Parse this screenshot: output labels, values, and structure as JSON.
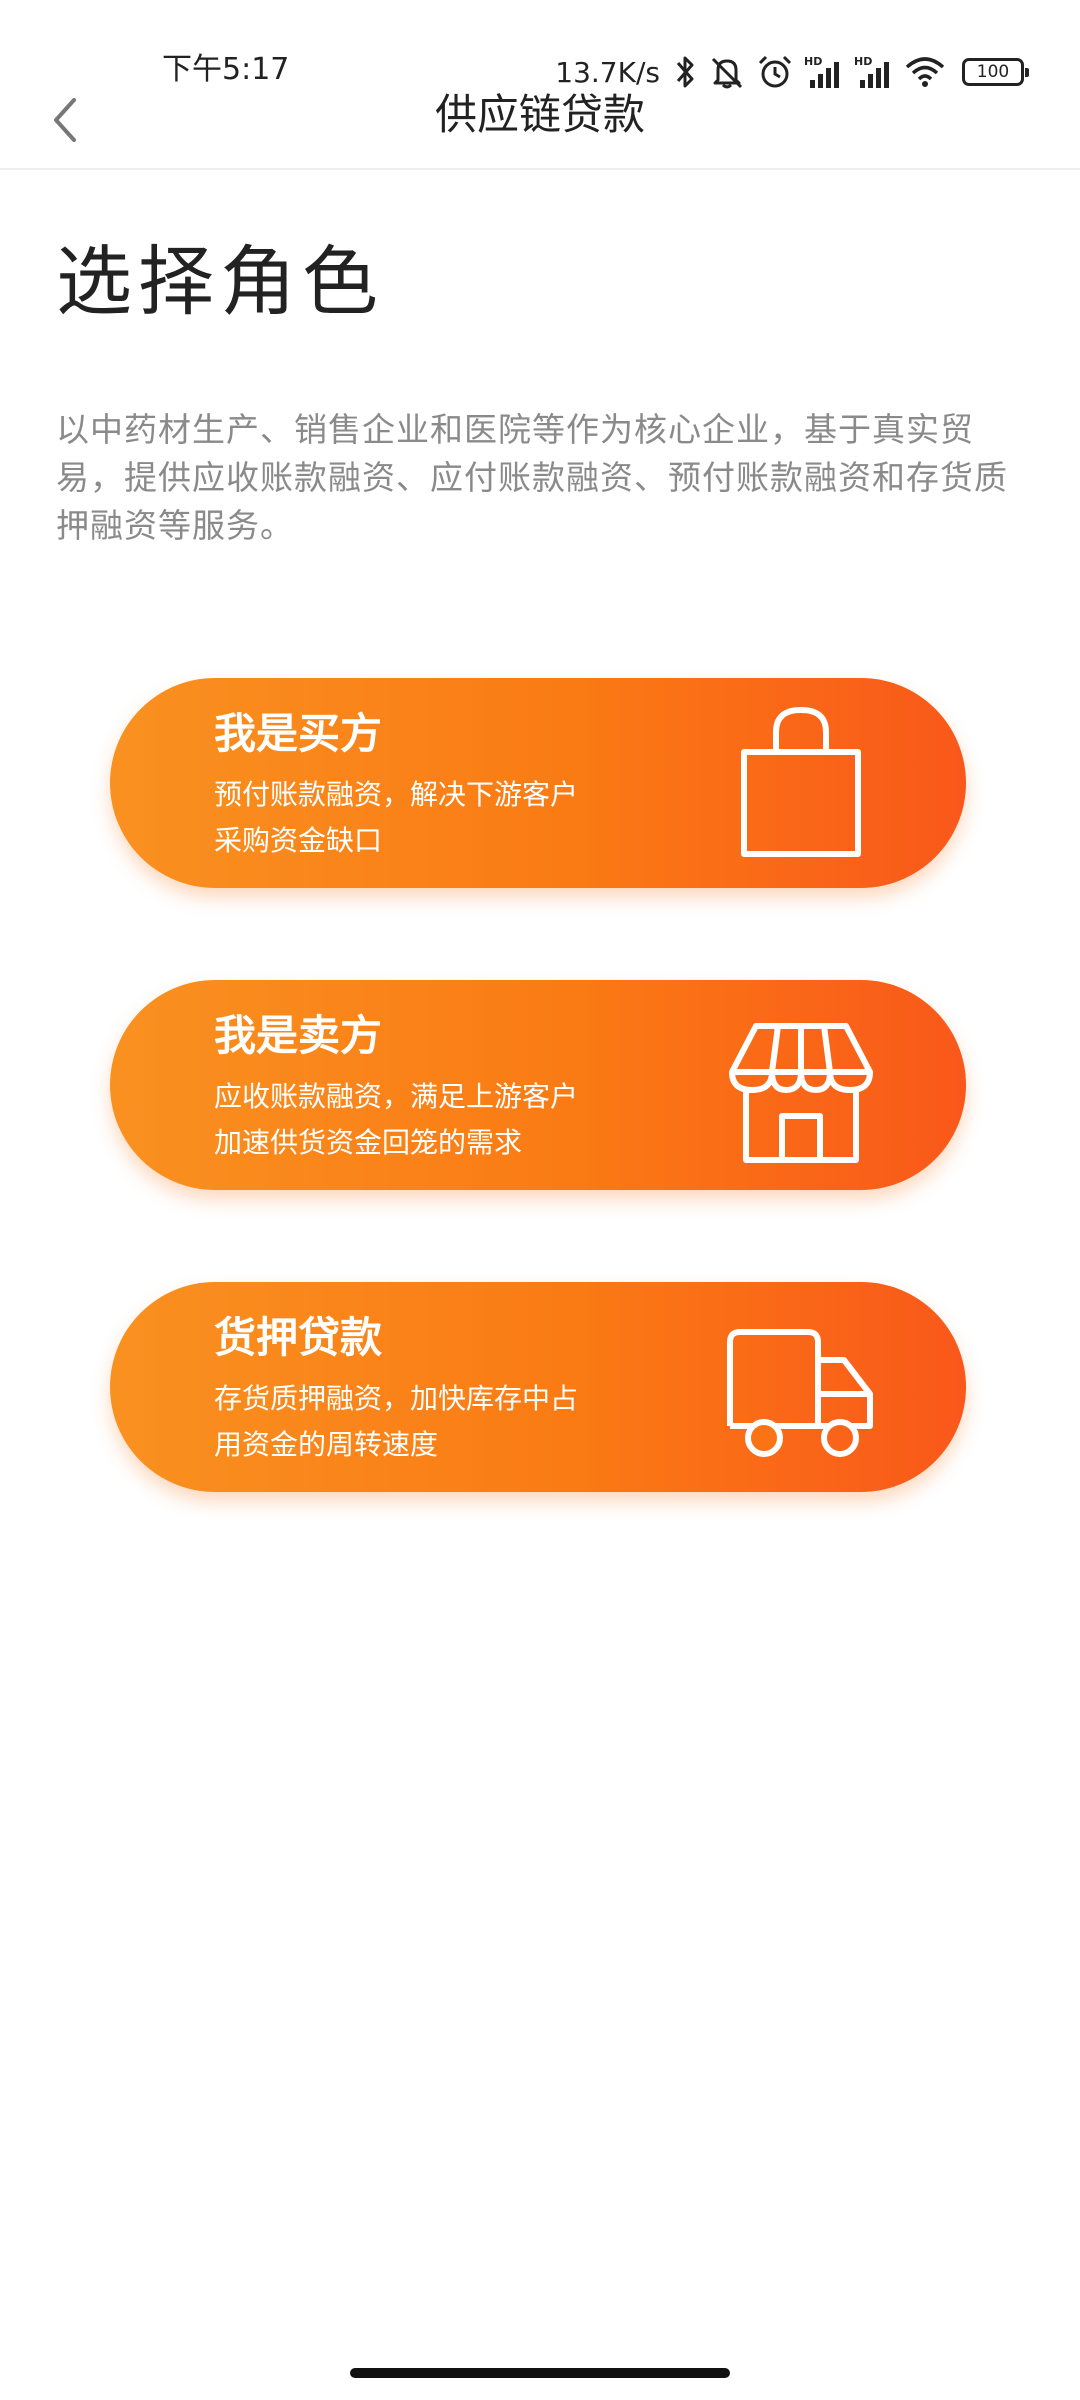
{
  "status_bar": {
    "time": "下午5:17",
    "net_speed": "13.7K/s",
    "battery": "100",
    "icons": [
      "bluetooth-icon",
      "mute-icon",
      "alarm-icon",
      "signal-hd-icon",
      "signal-hd-icon",
      "wifi-icon",
      "battery-icon"
    ]
  },
  "header": {
    "back_icon": "chevron-left-icon",
    "title": "供应链贷款"
  },
  "main": {
    "heading": "选择角色",
    "intro": "以中药材生产、销售企业和医院等作为核心企业，基于真实贸易，提供应收账款融资、应付账款融资、预付账款融资和存货质押融资等服务。",
    "roles": [
      {
        "title": "我是买方",
        "desc_line1": "预付账款融资，解决下游客户",
        "desc_line2": "采购资金缺口",
        "icon": "shopping-bag-icon"
      },
      {
        "title": "我是卖方",
        "desc_line1": "应收账款融资，满足上游客户",
        "desc_line2": "加速供货资金回笼的需求",
        "icon": "storefront-icon"
      },
      {
        "title": "货押贷款",
        "desc_line1": "存货质押融资，加快库存中占",
        "desc_line2": "用资金的周转速度",
        "icon": "truck-icon"
      }
    ]
  },
  "colors": {
    "accent_start": "#f99120",
    "accent_end": "#f9581a",
    "intro_text": "#8a8a8a"
  }
}
